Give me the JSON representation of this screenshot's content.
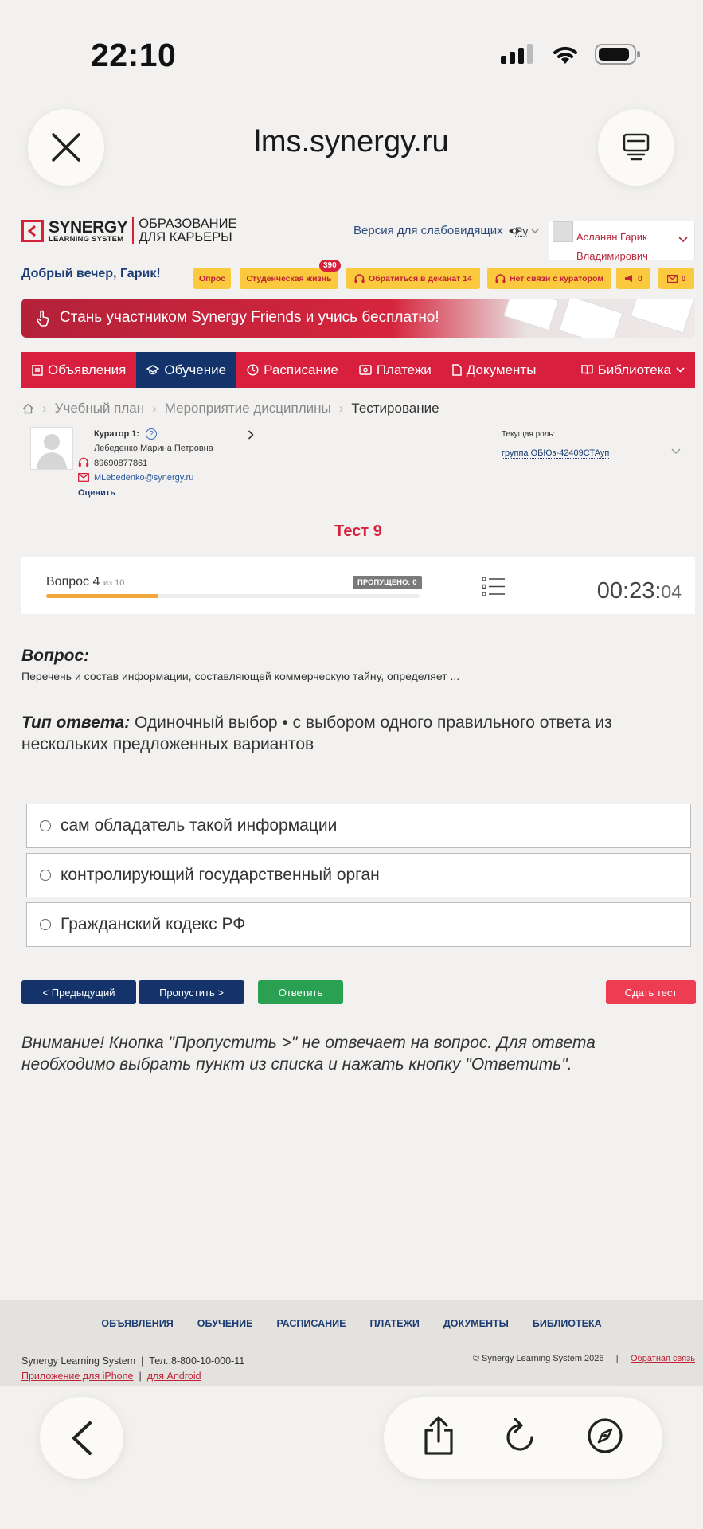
{
  "status_bar": {
    "time": "22:10"
  },
  "browser": {
    "url": "lms.synergy.ru"
  },
  "header": {
    "logo_name": "SYNERGY",
    "logo_sub": "LEARNING SYSTEM",
    "slogan_line1": "ОБРАЗОВАНИЕ",
    "slogan_line2": "ДЛЯ КАРЬЕРЫ",
    "vision_link": "Версия для слабовидящих",
    "lang": "Ру",
    "user_name": "Асланян Гарик Владимирович",
    "greeting": "Добрый вечер, Гарик!"
  },
  "quick_links": [
    {
      "label": "Опрос"
    },
    {
      "label": "Студенческая жизнь",
      "badge": "390"
    },
    {
      "label": "Обратиться в деканат 14"
    },
    {
      "label": "Нет связи с куратором"
    },
    {
      "label": "0"
    },
    {
      "label": "0"
    }
  ],
  "banner": {
    "text": "Стань участником Synergy Friends и учись бесплатно!"
  },
  "nav": [
    {
      "label": "Объявления"
    },
    {
      "label": "Обучение",
      "active": true
    },
    {
      "label": "Расписание"
    },
    {
      "label": "Платежи"
    },
    {
      "label": "Документы"
    },
    {
      "label": "Библиотека"
    }
  ],
  "breadcrumbs": [
    "Учебный план",
    "Мероприятие дисциплины",
    "Тестирование"
  ],
  "curator": {
    "title": "Куратор 1:",
    "name": "Лебеденко Марина Петровна",
    "phone": "89690877861",
    "email": "MLebedenko@synergy.ru",
    "rate": "Оценить"
  },
  "role": {
    "label": "Текущая роль:",
    "value": "группа ОБЮз-42409СТАуп"
  },
  "test": {
    "title": "Тест 9",
    "question_word": "Вопрос 4",
    "of_total": "из 10",
    "skipped": "ПРОПУЩЕНО: 0",
    "progress_fraction": 0.3,
    "timer_main": "00:23:",
    "timer_sec": "04"
  },
  "question": {
    "label": "Вопрос:",
    "text": "Перечень и состав информации, составляющей коммерческую тайну, определяет ...",
    "type_label": "Тип ответа:",
    "type_text": "Одиночный выбор • с выбором одного правильного ответа из нескольких предложенных вариантов",
    "options": [
      "сам обладатель такой информации",
      "контролирующий государственный орган",
      "Гражданский кодекс РФ"
    ]
  },
  "buttons": {
    "prev": "< Предыдущий",
    "skip": "Пропустить >",
    "answer": "Ответить",
    "submit": "Сдать тест"
  },
  "warning": "Внимание! Кнопка \"Пропустить >\" не отвечает на вопрос. Для ответа необходимо выбрать пункт из списка и нажать кнопку \"Ответить\".",
  "footer": {
    "links": [
      "ОБЪЯВЛЕНИЯ",
      "ОБУЧЕНИЕ",
      "РАСПИСАНИЕ",
      "ПЛАТЕЖИ",
      "ДОКУМЕНТЫ",
      "БИБЛИОТЕКА"
    ],
    "company": "Synergy Learning System",
    "phone": "Тел.:8-800-10-000-11",
    "iphone": "Приложение для iPhone",
    "android": "для Android",
    "copyright": "© Synergy Learning System 2026",
    "feedback": "Обратная связь"
  },
  "colors": {
    "brand_red": "#d91f3e",
    "brand_navy": "#13336a",
    "accent_yellow": "#fbc93d",
    "answer_green": "#2aa152"
  }
}
